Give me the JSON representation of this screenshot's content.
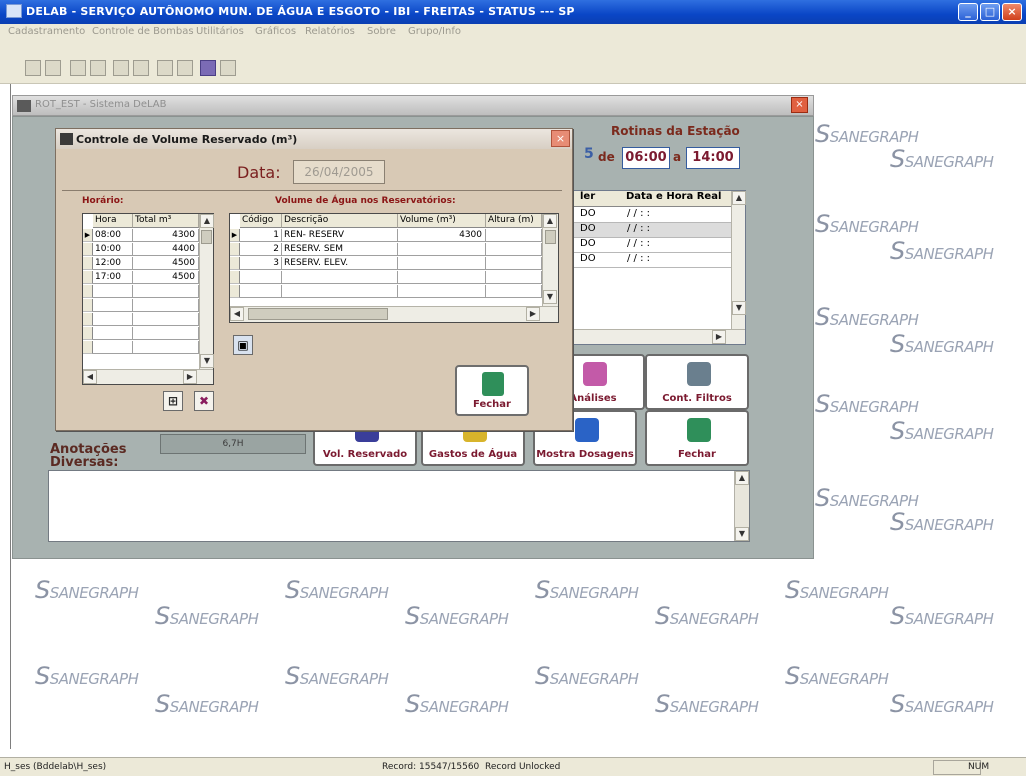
{
  "window": {
    "title": "DELAB - SERVIÇO AUTÔNOMO MUN. DE ÁGUA E ESGOTO - IBI - FREITAS - STATUS --- SP",
    "buttons": {
      "minimize": "_",
      "maximize": "□",
      "close": "×"
    }
  },
  "menubar": {
    "items": [
      "Cadastramento",
      "Controle de Bombas",
      "Utilitários",
      "Gráficos",
      "Relatórios",
      "Sobre",
      "Grupo/Info"
    ]
  },
  "watermark": {
    "text": "SANEGRAPH"
  },
  "child_window": {
    "title": "ROT_EST - Sistema DeLAB",
    "close": "×"
  },
  "background_form": {
    "rotinas_title": "Rotinas da Estação",
    "partial_digit": "5",
    "de_label": "de",
    "time_from": "06:00",
    "a_label": "a",
    "time_to": "14:00",
    "grid": {
      "headers": [
        "ler",
        "Data e Hora Real"
      ],
      "rows": [
        {
          "c1": "DO",
          "c2": "/ /  :  :"
        },
        {
          "c1": "DO",
          "c2": "/ /  :  :"
        },
        {
          "c1": "DO",
          "c2": "/ /  :  :"
        },
        {
          "c1": "DO",
          "c2": "/ /  :  :"
        }
      ]
    },
    "buttons": {
      "analises": "Análises",
      "cont_filtros": "Cont. Filtros",
      "vol_reservado": "Vol. Reservado",
      "gastos_agua": "Gastos de Água",
      "mostra_dosagens": "Mostra Dosagens",
      "fechar": "Fechar"
    },
    "anotacoes_label_1": "Anotações",
    "anotacoes_label_2": "Diversas:",
    "gray_bar_text": "6,7H"
  },
  "dialog": {
    "title": "Controle de Volume Reservado (m³)",
    "close": "×",
    "data_label": "Data:",
    "data_value": "26/04/2005",
    "horario_label": "Horário:",
    "volume_label": "Volume de Água nos Reservatórios:",
    "horario_table": {
      "headers": [
        "Hora",
        "Total m³"
      ],
      "rows": [
        {
          "hora": "08:00",
          "total": "4300",
          "current": true
        },
        {
          "hora": "10:00",
          "total": "4400",
          "current": false
        },
        {
          "hora": "12:00",
          "total": "4500",
          "current": false
        },
        {
          "hora": "17:00",
          "total": "4500",
          "current": false
        }
      ],
      "empty_rows": 5
    },
    "volume_table": {
      "headers": [
        "Código",
        "Descrição",
        "Volume (m³)",
        "Altura (m)"
      ],
      "rows": [
        {
          "codigo": "1",
          "descricao": "REN- RESERV",
          "volume": "4300",
          "altura": ""
        },
        {
          "codigo": "2",
          "descricao": "RESERV. SEM",
          "volume": "",
          "altura": ""
        },
        {
          "codigo": "3",
          "descricao": "RESERV. ELEV.",
          "volume": "",
          "altura": ""
        }
      ],
      "empty_rows": 2
    },
    "fechar": "Fechar",
    "add_icon": "add-icon",
    "delete_icon": "delete-icon",
    "save_icon": "save-icon"
  },
  "statusbar": {
    "left": "H_ses (Bddelab\\H_ses)",
    "record": "Record: 15547/15560",
    "lock": "Record Unlocked",
    "num": "NUM"
  }
}
